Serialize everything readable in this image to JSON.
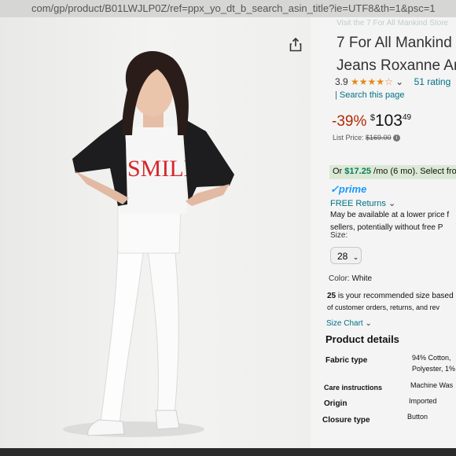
{
  "browser": {
    "url": "com/gp/product/B01LWJLP0Z/ref=ppx_yo_dt_b_search_asin_title?ie=UTF8&th=1&psc=1"
  },
  "image": {
    "shirt_text": "SMILE"
  },
  "product": {
    "top_cut_text": "Visit the 7 For All Mankind Store",
    "title_line1": "7 For All Mankind",
    "title_line2": "Jeans Roxanne An",
    "rating": "3.9",
    "stars": "★★★★☆",
    "ratings_count": "51 rating",
    "search_link": "| Search this page",
    "discount": "-39%",
    "currency": "$",
    "price_whole": "103",
    "price_cents": "49",
    "list_price_label": "List Price:",
    "list_price_value": "$169.00",
    "emi_prefix": "Or",
    "emi_amount": "$17.25",
    "emi_suffix": "/mo (6 mo). Select fro",
    "prime_check": "✓",
    "prime": "prime",
    "free_returns": "FREE Returns",
    "availability_line1": "May be available at a lower price f",
    "availability_line2": "sellers, potentially without free P",
    "size_label": "Size:",
    "size_value": "28",
    "color_label": "Color:",
    "color_value": "White",
    "rec_bold": "25",
    "rec_line1_rest": " is your recommended size based",
    "rec_line2": "of customer orders, returns, and rev",
    "size_chart": "Size Chart",
    "details_heading": "Product details",
    "details": [
      {
        "label": "Fabric type",
        "value1": "94% Cotton,",
        "value2": "Polyester, 1%"
      },
      {
        "label": "Care instructions",
        "value1": "Machine Was"
      },
      {
        "label": "Origin",
        "value1": "Imported"
      },
      {
        "label": "Closure type",
        "value1": "Button"
      }
    ]
  },
  "colors": {
    "price_red": "#b12704",
    "link_blue": "#007185",
    "prime_blue": "#1a98ff",
    "emi_green_bg": "#dbe9d4",
    "star_orange": "#e28a16"
  }
}
